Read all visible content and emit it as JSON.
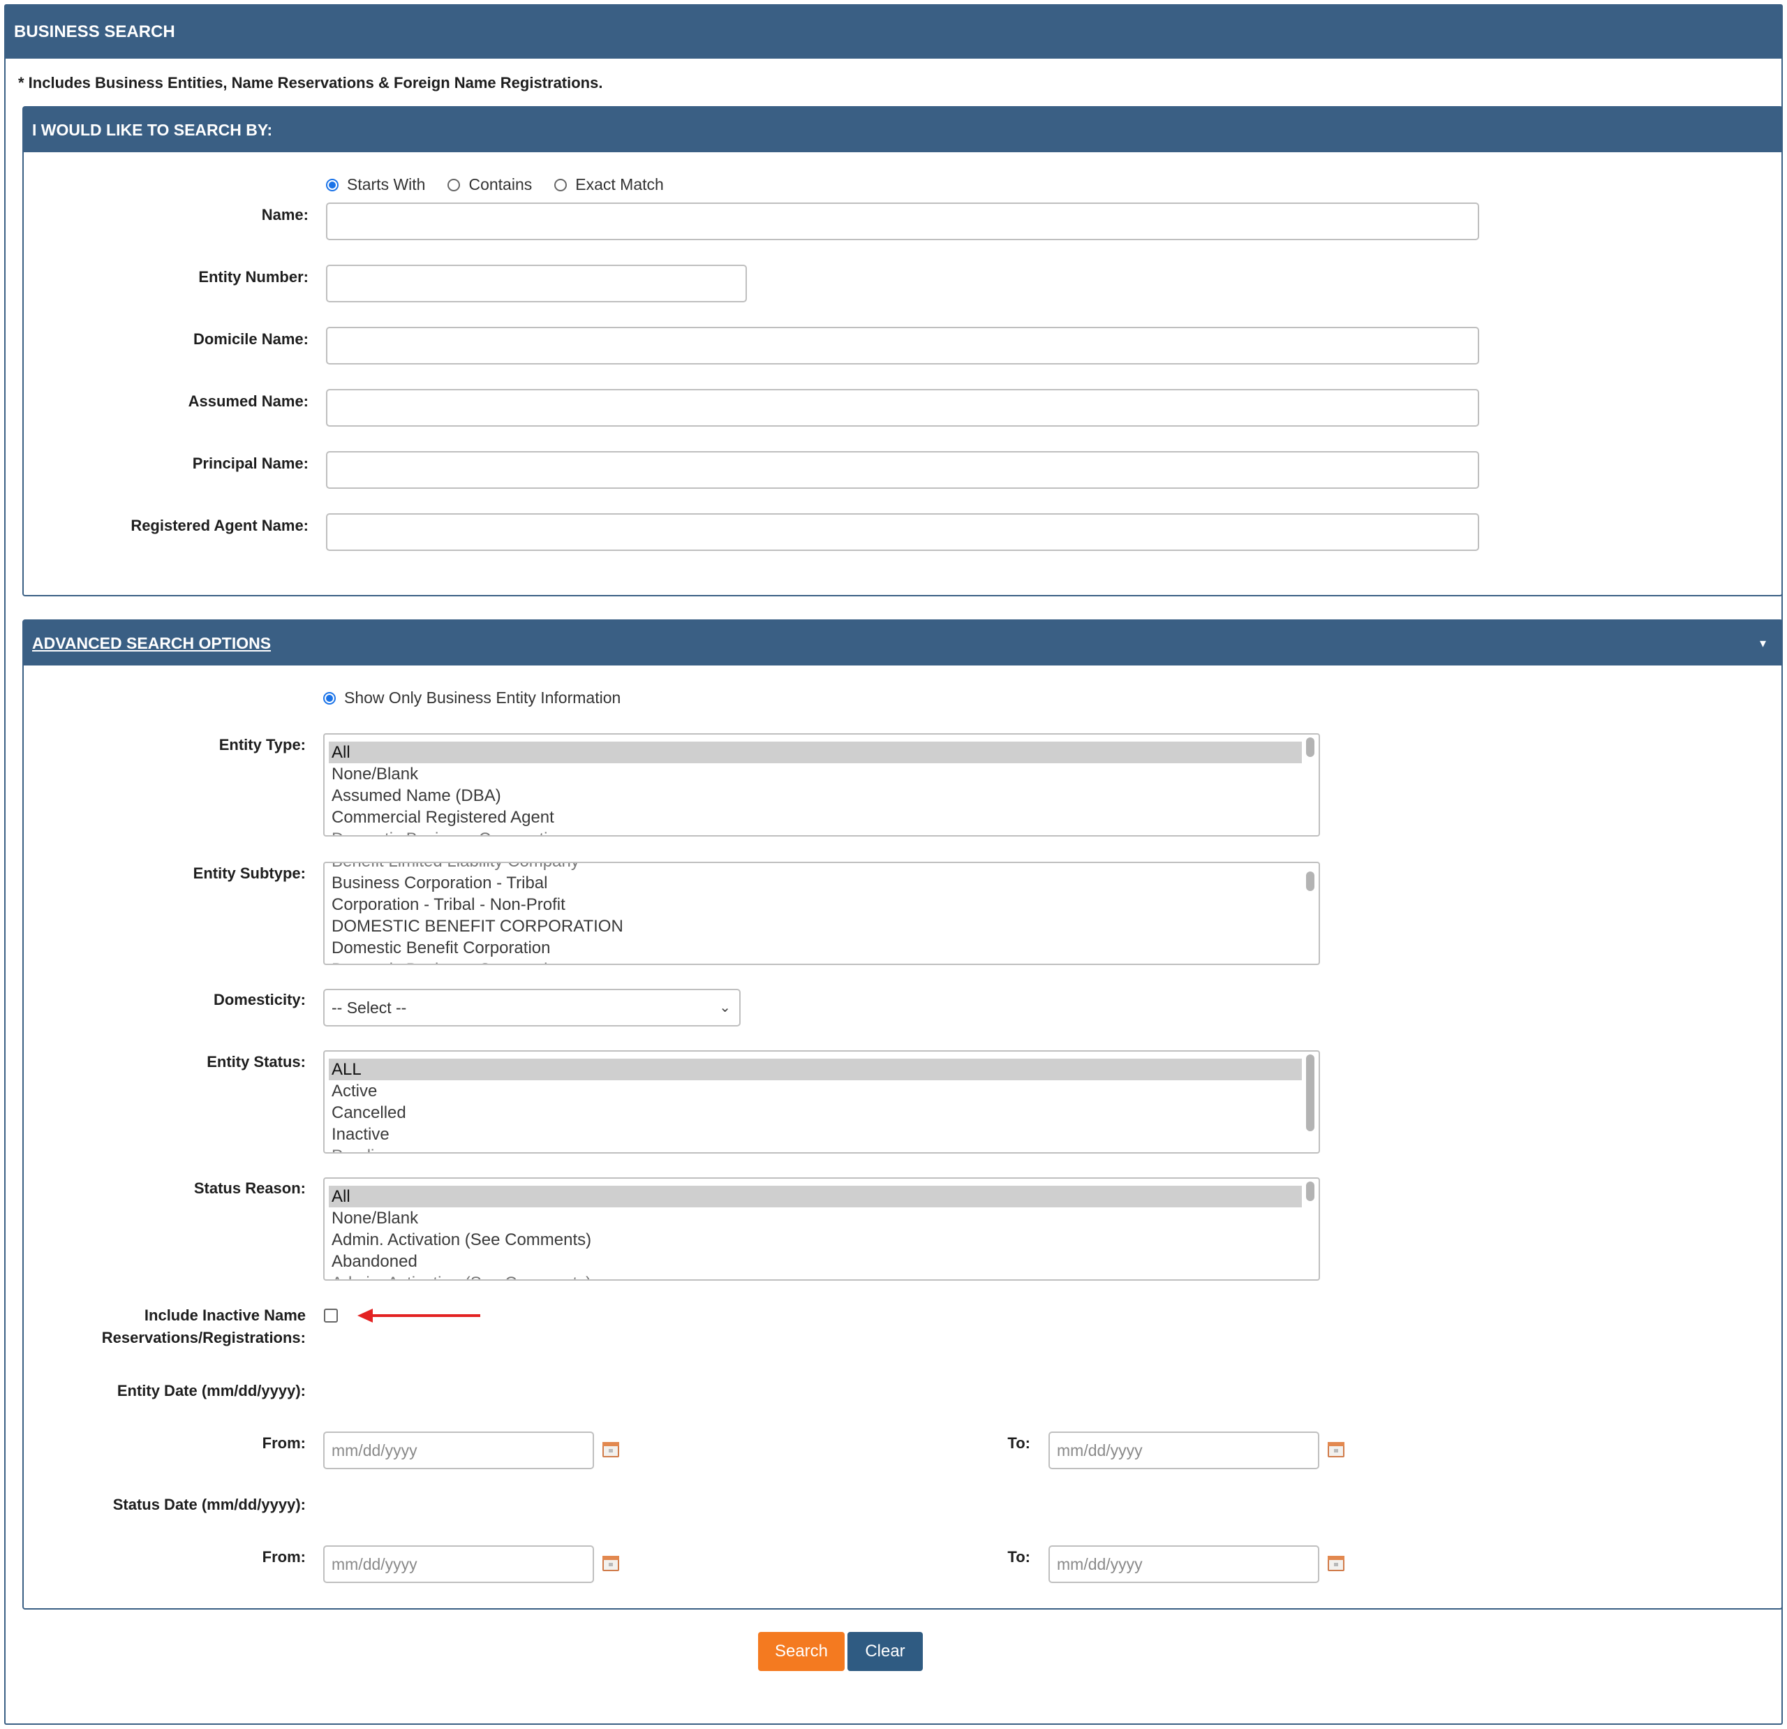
{
  "header": {
    "title": "BUSINESS SEARCH"
  },
  "note": "* Includes Business Entities, Name Reservations & Foreign Name Registrations.",
  "search_by": {
    "title": "I WOULD LIKE TO SEARCH BY:",
    "match_modes": [
      {
        "label": "Starts With",
        "selected": true
      },
      {
        "label": "Contains",
        "selected": false
      },
      {
        "label": "Exact Match",
        "selected": false
      }
    ],
    "fields": {
      "name": {
        "label": "Name:",
        "value": ""
      },
      "entity_number": {
        "label": "Entity Number:",
        "value": ""
      },
      "domicile_name": {
        "label": "Domicile Name:",
        "value": ""
      },
      "assumed_name": {
        "label": "Assumed Name:",
        "value": ""
      },
      "principal_name": {
        "label": "Principal Name:",
        "value": ""
      },
      "registered_agent_name": {
        "label": "Registered Agent Name:",
        "value": ""
      }
    }
  },
  "advanced": {
    "title": "ADVANCED SEARCH OPTIONS",
    "show_only_label": "Show Only Business Entity Information",
    "entity_type": {
      "label": "Entity Type:",
      "options": [
        "All",
        "None/Blank",
        "Assumed Name (DBA)",
        "Commercial Registered Agent",
        "Domestic Business Corporation"
      ],
      "selected": "All"
    },
    "entity_subtype": {
      "label": "Entity Subtype:",
      "options": [
        "Benefit Limited Liability Company",
        "Business Corporation - Tribal",
        "Corporation - Tribal - Non-Profit",
        "DOMESTIC BENEFIT CORPORATION",
        "Domestic Benefit Corporation",
        "Domestic Business Corporation"
      ]
    },
    "domesticity": {
      "label": "Domesticity:",
      "value": "-- Select --"
    },
    "entity_status": {
      "label": "Entity Status:",
      "options": [
        "ALL",
        "Active",
        "Cancelled",
        "Inactive",
        "Pending"
      ],
      "selected": "ALL"
    },
    "status_reason": {
      "label": "Status Reason:",
      "options": [
        "All",
        "None/Blank",
        "Admin. Activation (See Comments)",
        "Abandoned",
        "Admin. Activation (See Comments)"
      ],
      "selected": "All"
    },
    "include_inactive": {
      "label_line1": "Include Inactive Name",
      "label_line2": "Reservations/Registrations:",
      "checked": false
    },
    "entity_date": {
      "label": "Entity Date (mm/dd/yyyy):",
      "from_label": "From:",
      "to_label": "To:",
      "placeholder": "mm/dd/yyyy"
    },
    "status_date": {
      "label": "Status Date (mm/dd/yyyy):",
      "from_label": "From:",
      "to_label": "To:",
      "placeholder": "mm/dd/yyyy"
    }
  },
  "actions": {
    "search_label": "Search",
    "clear_label": "Clear"
  },
  "colors": {
    "header": "#3a5f84",
    "search_button": "#f47a20",
    "clear_button": "#2f5b82",
    "radio_selected": "#1a73e8",
    "annotation_arrow": "#e32222"
  },
  "icons": {
    "calendar": "calendar-icon",
    "caret": "caret-down-icon",
    "arrow": "red-arrow-annotation"
  }
}
